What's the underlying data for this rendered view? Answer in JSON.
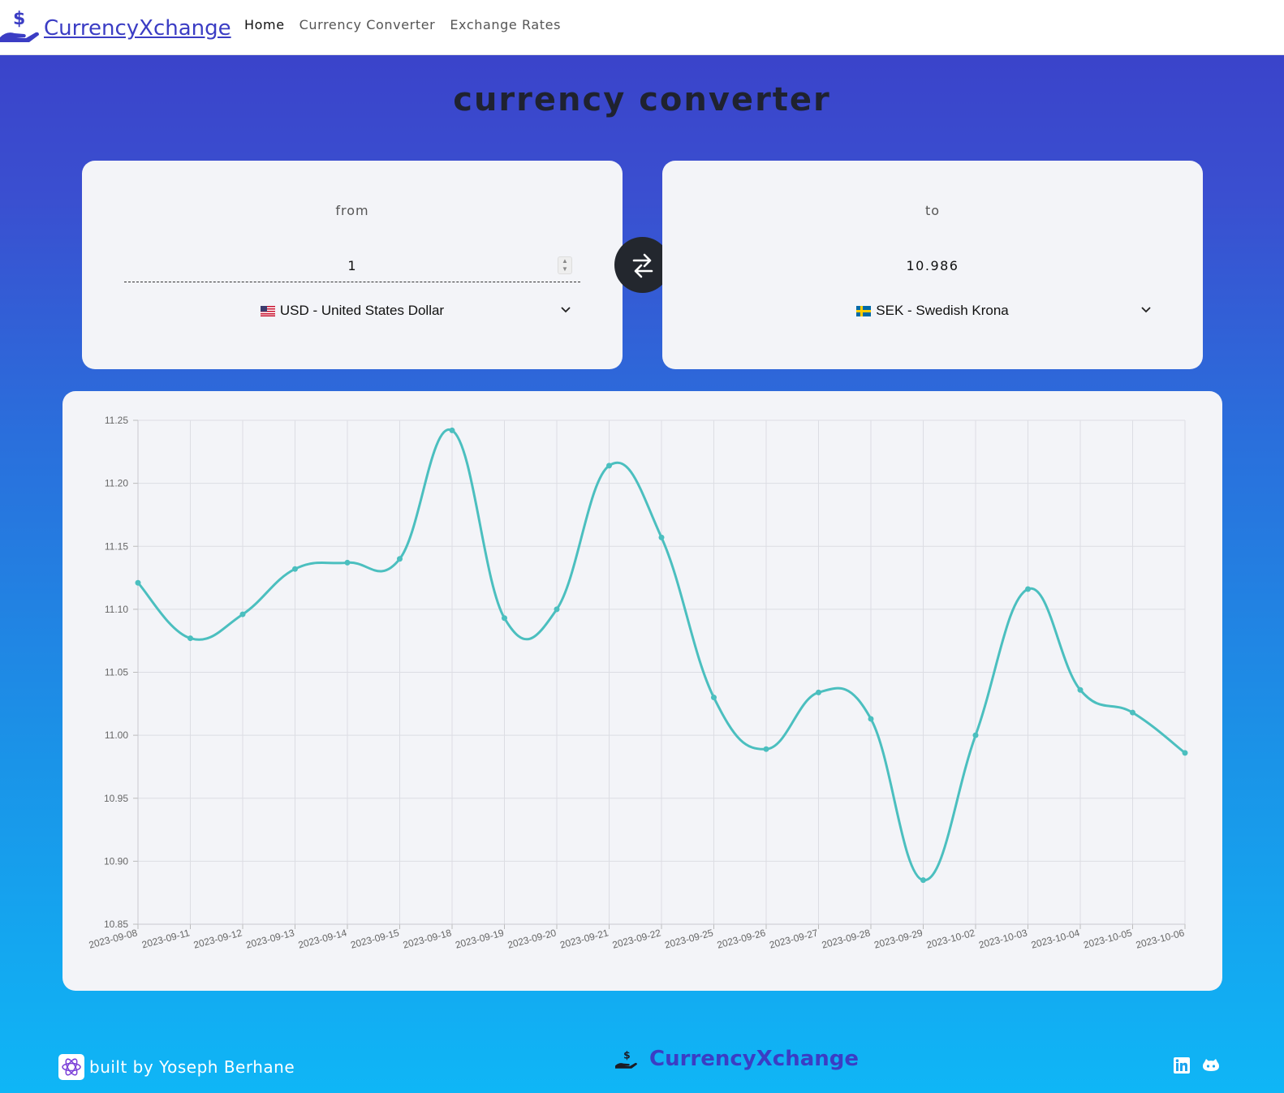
{
  "navbar": {
    "brand": "CurrencyXchange",
    "links": [
      "Home",
      "Currency Converter",
      "Exchange Rates"
    ]
  },
  "page": {
    "title": "currency converter"
  },
  "converter": {
    "from_label": "from",
    "amount": "1",
    "from_currency": "USD - United States Dollar",
    "to_label": "to",
    "result": "10.986",
    "to_currency": "SEK - Swedish Krona"
  },
  "footer": {
    "credit": "built by Yoseph Berhane",
    "brand": "CurrencyXchange"
  },
  "colors": {
    "brand": "#3b3dc4",
    "line": "#4bbfbf",
    "swap_button": "#23272e"
  },
  "icons": [
    "hand-dollar-icon",
    "swap-arrows-icon",
    "chevron-down-icon",
    "us-flag-icon",
    "se-flag-icon",
    "linkedin-icon",
    "github-icon",
    "react-icon"
  ],
  "chart_data": {
    "type": "line",
    "x": [
      "2023-09-08",
      "2023-09-11",
      "2023-09-12",
      "2023-09-13",
      "2023-09-14",
      "2023-09-15",
      "2023-09-18",
      "2023-09-19",
      "2023-09-20",
      "2023-09-21",
      "2023-09-22",
      "2023-09-25",
      "2023-09-26",
      "2023-09-27",
      "2023-09-28",
      "2023-09-29",
      "2023-10-02",
      "2023-10-03",
      "2023-10-04",
      "2023-10-05",
      "2023-10-06"
    ],
    "values": [
      11.121,
      11.077,
      11.096,
      11.132,
      11.137,
      11.14,
      11.242,
      11.093,
      11.1,
      11.214,
      11.157,
      11.03,
      10.989,
      11.034,
      11.013,
      10.885,
      11.0,
      11.116,
      11.036,
      11.018,
      10.986
    ],
    "ylim": [
      10.85,
      11.25
    ],
    "yticks": [
      "10.85",
      "10.90",
      "10.95",
      "11.00",
      "11.05",
      "11.10",
      "11.15",
      "11.20",
      "11.25"
    ],
    "grid": true
  }
}
